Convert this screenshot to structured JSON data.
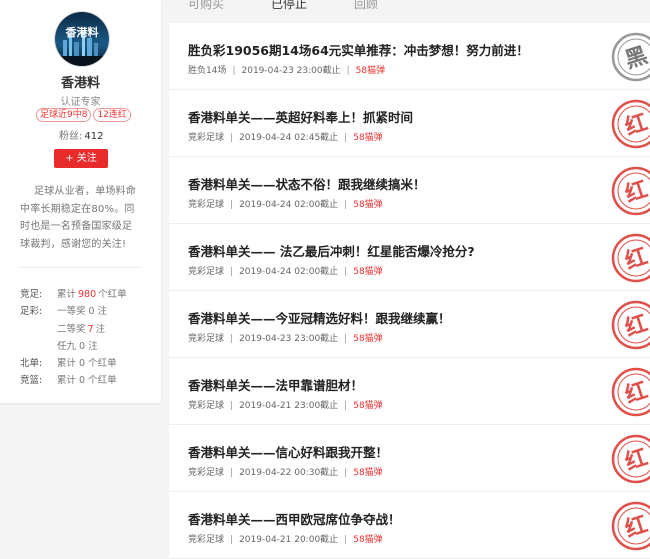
{
  "colors": {
    "accent": "#e82b2b",
    "stamp_red": "#e0504a",
    "stamp_gray": "#888888"
  },
  "tabs": [
    {
      "label": "可购买",
      "active": false
    },
    {
      "label": "已停止",
      "active": true
    },
    {
      "label": "回顾",
      "active": false
    }
  ],
  "profile": {
    "avatar_text": "香港料",
    "name": "香港料",
    "cert": "认证专家",
    "tags": [
      "足球近9中8",
      "12连红"
    ],
    "fans_label": "粉丝:",
    "fans_count": "412",
    "follow_label": "+ 关注",
    "bio": "足球从业者，单场料命中率长期稳定在80%。同时也是一名预备国家级足球裁判，感谢您的关注!",
    "stats": [
      {
        "label": "竞足:",
        "pre": "累计",
        "num": "980",
        "post": "个红单"
      },
      {
        "label": "足彩:",
        "pre": "一等奖",
        "num": "0",
        "post": "注",
        "plain": true
      },
      {
        "label": "",
        "pre": "二等奖",
        "num": "7",
        "post": "注"
      },
      {
        "label": "",
        "pre": "任九",
        "num": "0",
        "post": "注",
        "plain": true
      },
      {
        "label": "北单:",
        "pre": "累计",
        "num": "0",
        "post": "个红单",
        "plain": true
      },
      {
        "label": "竞篮:",
        "pre": "累计",
        "num": "0",
        "post": "个红单",
        "plain": true
      }
    ]
  },
  "items": [
    {
      "title": "胜负彩19056期14场64元实单推荐：冲击梦想！努力前进！",
      "category": "胜负14场",
      "time": "2019-04-23 23:00截止",
      "price": "58猫弹",
      "stamp": "黑"
    },
    {
      "title": "香港料单关——英超好料奉上！抓紧时间",
      "category": "竞彩足球",
      "time": "2019-04-24 02:45截止",
      "price": "58猫弹",
      "stamp": "红"
    },
    {
      "title": "香港料单关——状态不俗！跟我继续搞米！",
      "category": "竞彩足球",
      "time": "2019-04-24 02:00截止",
      "price": "58猫弹",
      "stamp": "红"
    },
    {
      "title": "香港料单关—— 法乙最后冲刺！红星能否爆冷抢分?",
      "category": "竞彩足球",
      "time": "2019-04-24 02:00截止",
      "price": "58猫弹",
      "stamp": "红"
    },
    {
      "title": "香港料单关——今亚冠精选好料！跟我继续赢！",
      "category": "竞彩足球",
      "time": "2019-04-23 23:00截止",
      "price": "58猫弹",
      "stamp": "红"
    },
    {
      "title": "香港料单关——法甲靠谱胆材！",
      "category": "竞彩足球",
      "time": "2019-04-21 23:00截止",
      "price": "58猫弹",
      "stamp": "红"
    },
    {
      "title": "香港料单关——信心好料跟我开整！",
      "category": "竞彩足球",
      "time": "2019-04-22 00:30截止",
      "price": "58猫弹",
      "stamp": "红"
    },
    {
      "title": "香港料单关——西甲欧冠席位争夺战！",
      "category": "竞彩足球",
      "time": "2019-04-21 20:00截止",
      "price": "58猫弹",
      "stamp": "红"
    }
  ]
}
